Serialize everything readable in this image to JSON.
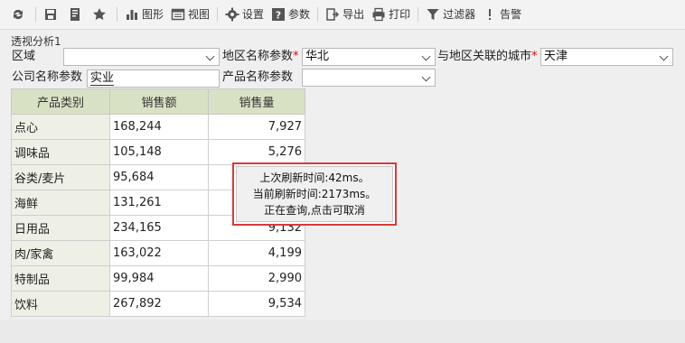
{
  "toolbar": {
    "items": [
      {
        "icon": "refresh-icon",
        "label": ""
      },
      {
        "icon": "save-icon",
        "label": ""
      },
      {
        "icon": "save-as-icon",
        "label": ""
      },
      {
        "icon": "star-icon",
        "label": ""
      },
      {
        "icon": "chart-icon",
        "label": "图形"
      },
      {
        "icon": "view-icon",
        "label": "视图"
      },
      {
        "icon": "gear-icon",
        "label": "设置"
      },
      {
        "icon": "help-icon",
        "label": "参数"
      },
      {
        "icon": "export-icon",
        "label": "导出"
      },
      {
        "icon": "print-icon",
        "label": "打印"
      },
      {
        "icon": "filter-icon",
        "label": "过滤器"
      },
      {
        "icon": "alert-icon",
        "label": "告警"
      }
    ]
  },
  "report_title": "透视分析1",
  "params": {
    "region_label": "区域",
    "region_value": "",
    "area_name_label": "地区名称参数",
    "area_name_required": "*",
    "area_name_value": "华北",
    "city_label": "与地区关联的城市",
    "city_required": "*",
    "city_value": "天津",
    "company_label": "公司名称参数",
    "company_value": "实业",
    "product_label": "产品名称参数",
    "product_value": ""
  },
  "table": {
    "headers": [
      "产品类别",
      "销售额",
      "销售量"
    ],
    "rows": [
      {
        "category": "点心",
        "sales": "168,244",
        "qty": "7,927"
      },
      {
        "category": "调味品",
        "sales": "105,148",
        "qty": "5,276"
      },
      {
        "category": "谷类/麦片",
        "sales": "95,684",
        "qty": ""
      },
      {
        "category": "海鲜",
        "sales": "131,261",
        "qty": ""
      },
      {
        "category": "日用品",
        "sales": "234,165",
        "qty": "9,132"
      },
      {
        "category": "肉/家禽",
        "sales": "163,022",
        "qty": "4,199"
      },
      {
        "category": "特制品",
        "sales": "99,984",
        "qty": "2,990"
      },
      {
        "category": "饮料",
        "sales": "267,892",
        "qty": "9,534"
      }
    ]
  },
  "tooltip": {
    "line1": "上次刷新时间:42ms。",
    "line2": "当前刷新时间:2173ms。",
    "line3": "正在查询,点击可取消"
  }
}
